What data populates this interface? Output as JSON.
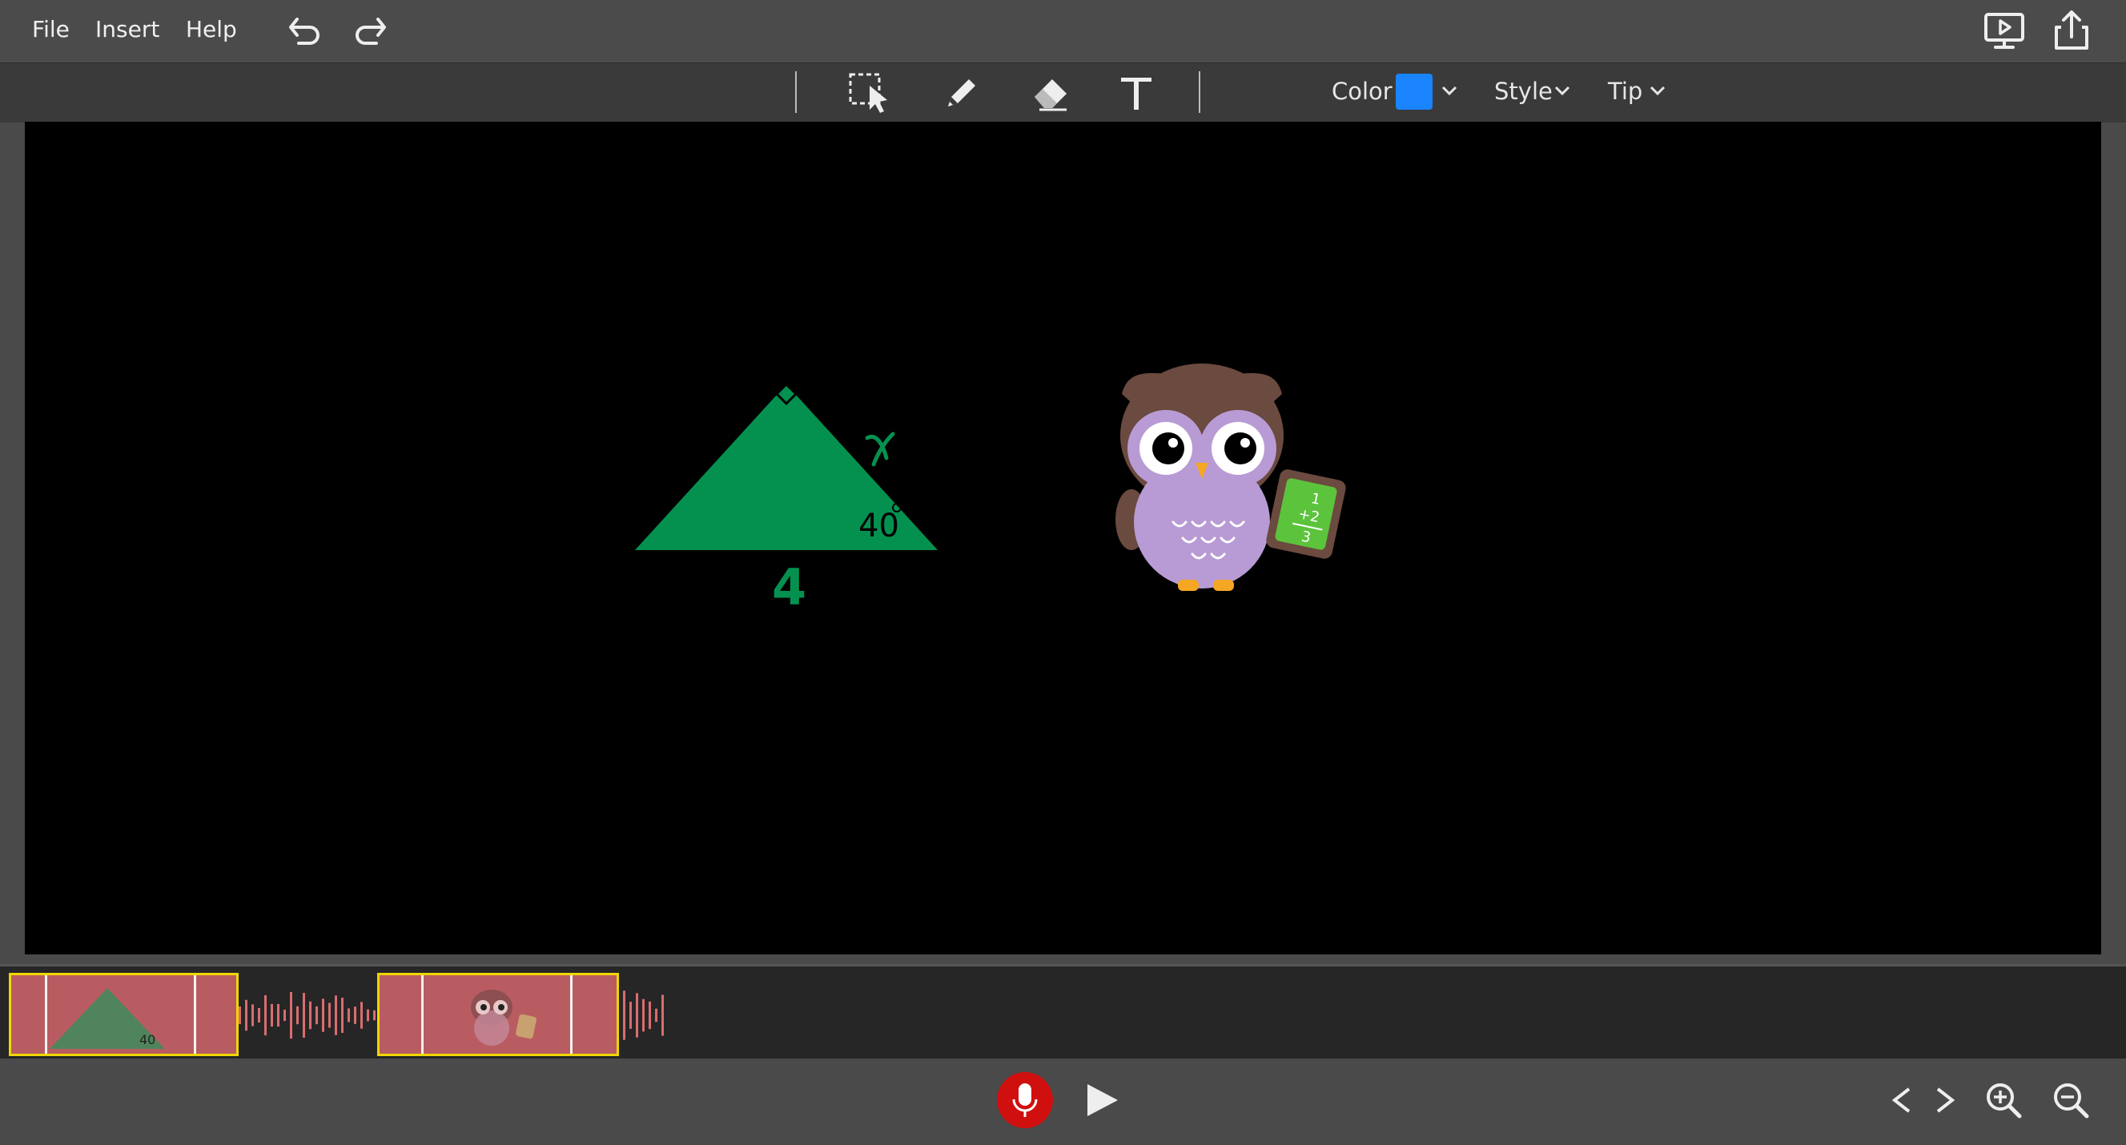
{
  "menu": {
    "file": "File",
    "insert": "Insert",
    "help": "Help"
  },
  "toolbar": {
    "color_label": "Color",
    "style_label": "Style",
    "tip_label": "Tip",
    "selected_color": "#1a84ff"
  },
  "canvas": {
    "side_label": "x",
    "base_label": "4",
    "angle_label": "40",
    "triangle_color": "#04914f",
    "background": "#000000"
  },
  "icons": {
    "undo": "undo-icon",
    "redo": "redo-icon",
    "present": "present-icon",
    "share": "share-icon",
    "select": "select-icon",
    "pen": "pencil-icon",
    "eraser": "eraser-icon",
    "text": "text-icon",
    "mic": "microphone-icon",
    "play": "play-icon",
    "prev": "chevron-left-icon",
    "next": "chevron-right-icon",
    "zoom_in": "zoom-in-icon",
    "zoom_out": "zoom-out-icon"
  },
  "timeline": {
    "clips": [
      {
        "name": "triangle-slide"
      },
      {
        "name": "owl-slide"
      }
    ],
    "waveform_color": "#d96d70",
    "clip_border_color": "#f0d600"
  }
}
